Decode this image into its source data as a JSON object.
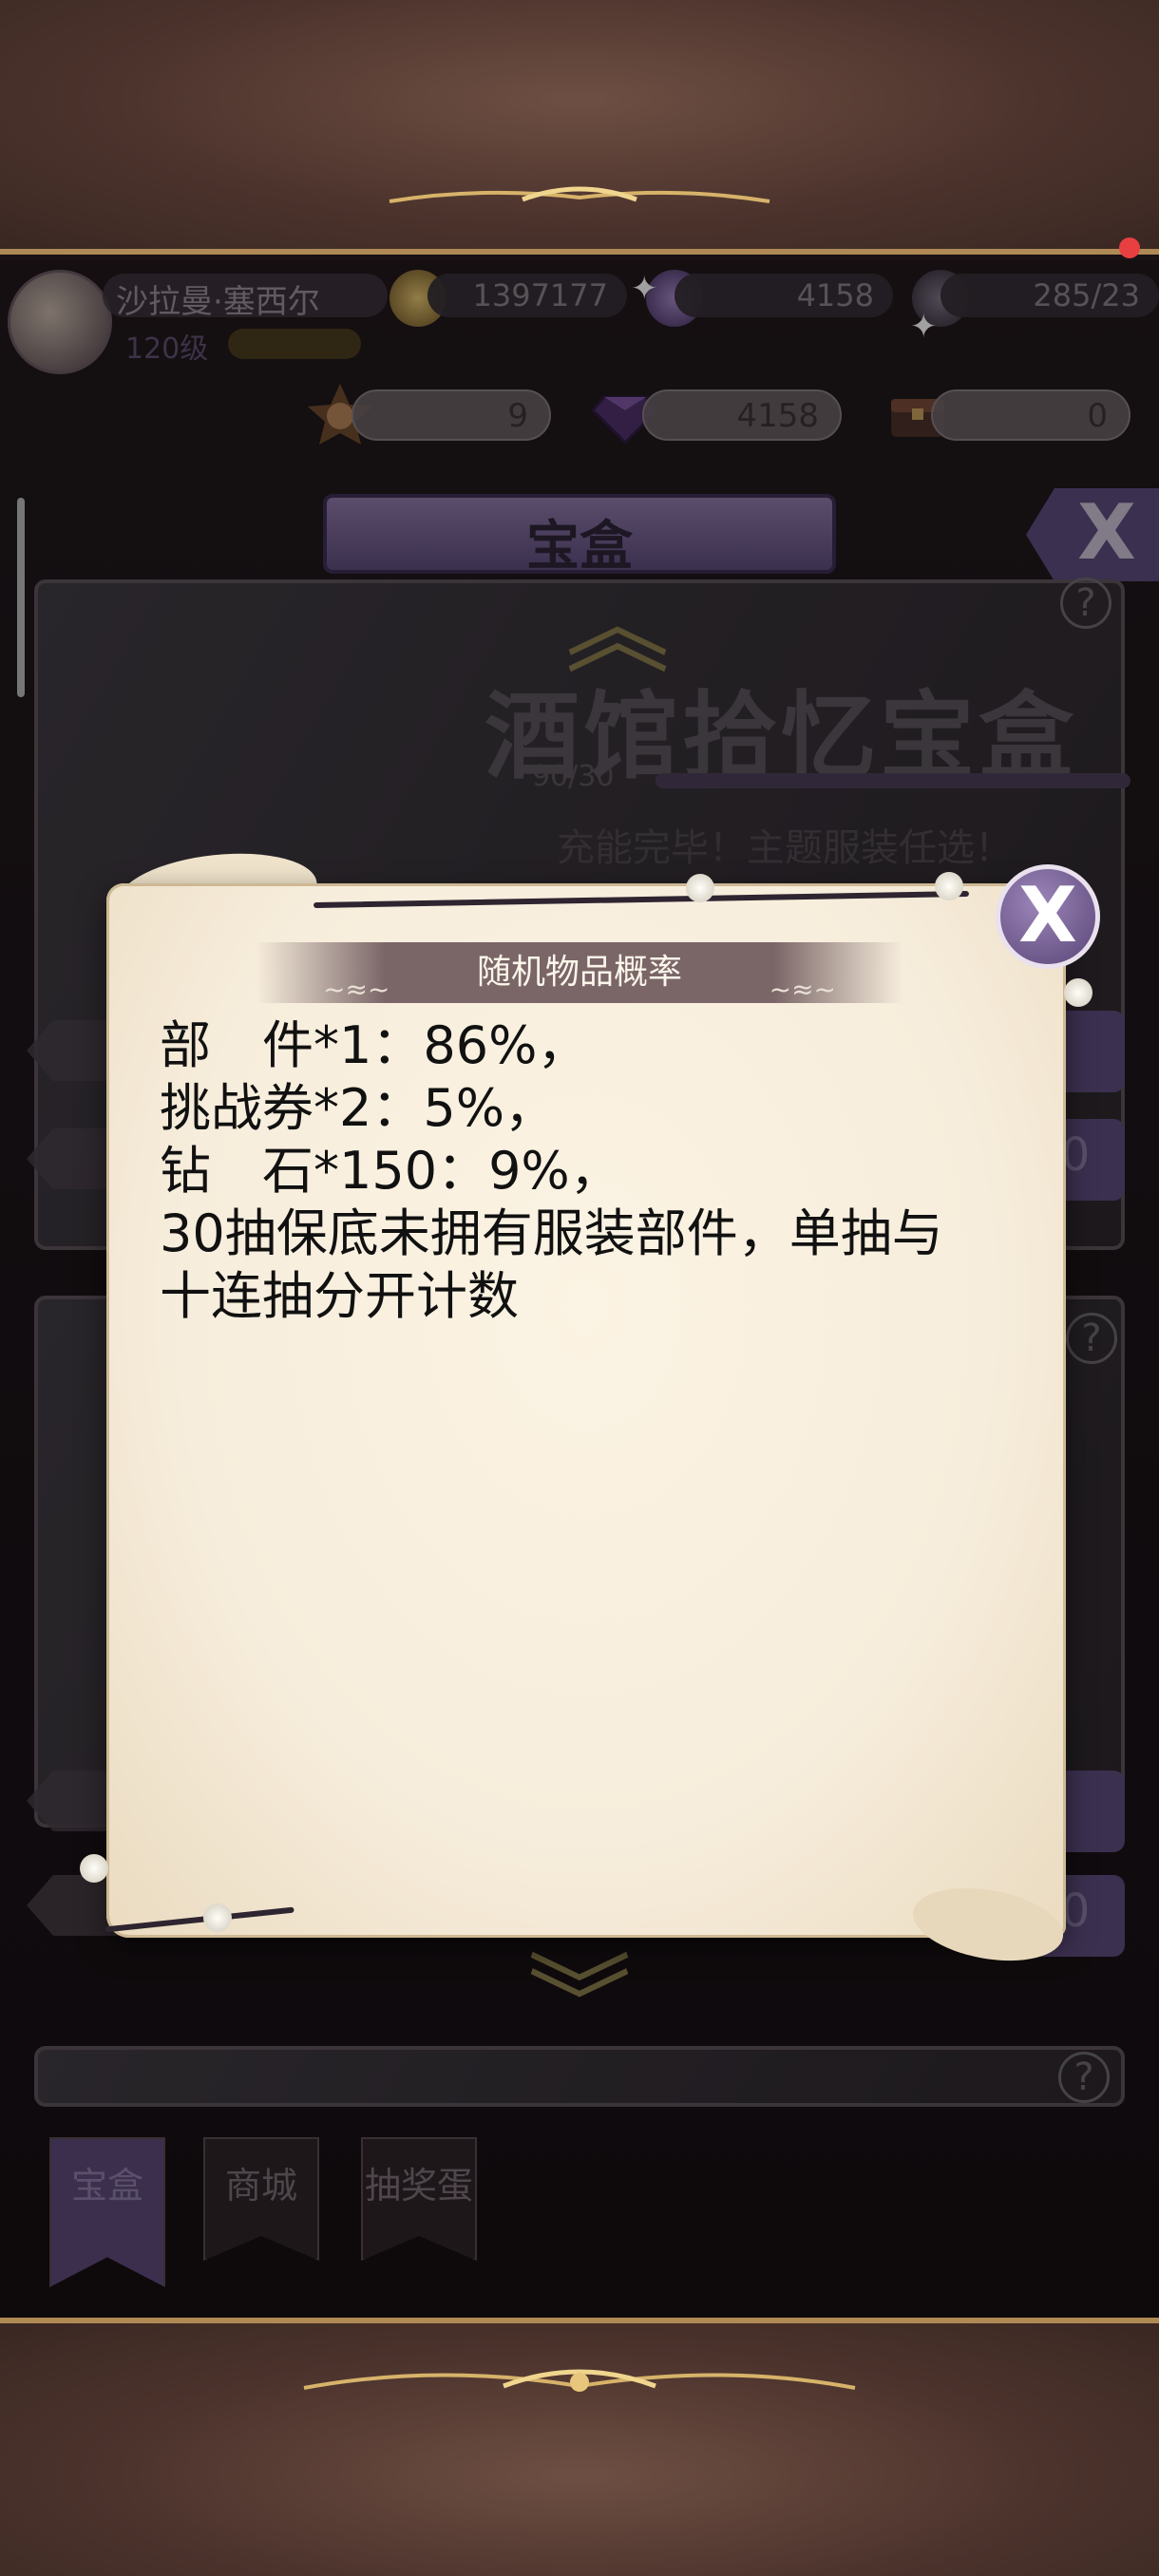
{
  "header": {
    "player_name": "沙拉曼·塞西尔",
    "player_level": "120级",
    "gold": "1397177",
    "gems_top": "4158",
    "stamina": "285/23"
  },
  "currencies": [
    {
      "icon": "ticket-icon",
      "value": "9"
    },
    {
      "icon": "diamond-icon",
      "value": "4158"
    },
    {
      "icon": "chest-icon",
      "value": "0"
    }
  ],
  "page_title": "宝盒",
  "close_label": "X",
  "banner": {
    "title": "酒馆拾忆宝盒",
    "progress": "90/30",
    "subtitle": "充能完毕！主题服装任选！"
  },
  "side_button_value": "0",
  "popup": {
    "title": "随机物品概率",
    "lines": [
      "部　件*1：86%，",
      "挑战券*2：5%，",
      "钻　石*150：9%，",
      "30抽保底未拥有服装部件，单抽与",
      "十连抽分开计数"
    ],
    "close_label": "X"
  },
  "tabs": [
    {
      "label": "宝盒",
      "active": true
    },
    {
      "label": "商城",
      "active": false
    },
    {
      "label": "抽奖蛋",
      "active": false
    }
  ],
  "help_label": "?"
}
